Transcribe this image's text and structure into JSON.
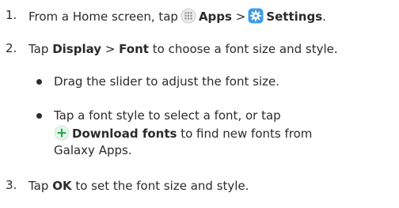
{
  "steps": [
    {
      "number": "1.",
      "text_a": "From a Home screen, tap",
      "apps": "Apps",
      "sep": ">",
      "settings": "Settings",
      "end": "."
    },
    {
      "number": "2.",
      "text_a": "Tap",
      "display": "Display",
      "sep": ">",
      "font": "Font",
      "text_b": "to choose a font size and style.",
      "bullets": [
        {
          "text": "Drag the slider to adjust the font size."
        },
        {
          "line1": "Tap a font style to select a font, or tap",
          "download": "Download fonts",
          "line2_rest": "to find new fonts from",
          "line3": "Galaxy Apps."
        }
      ]
    },
    {
      "number": "3.",
      "text_a": "Tap",
      "ok": "OK",
      "text_b": "to set the font size and style."
    }
  ],
  "icons": {
    "apps": "apps-grid-icon",
    "settings": "settings-gear-icon",
    "add": "plus-circle-icon"
  },
  "colors": {
    "text": "#2b2b2b",
    "settings_blue": "#3c9be8",
    "plus_green": "#1eaa4a",
    "apps_gray": "#9a9a9a"
  }
}
